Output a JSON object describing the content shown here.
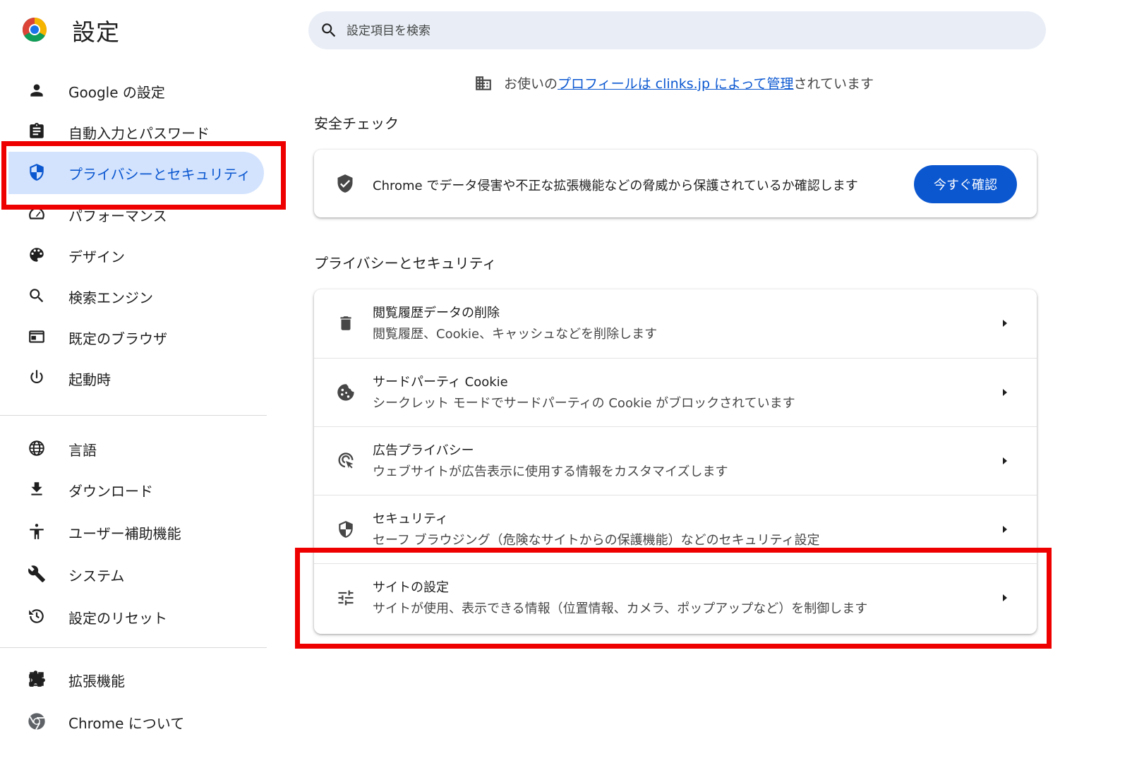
{
  "header": {
    "app_title": "設定",
    "search_placeholder": "設定項目を検索"
  },
  "sidebar": {
    "items": [
      {
        "label": "Google の設定",
        "icon": "person-icon"
      },
      {
        "label": "自動入力とパスワード",
        "icon": "clipboard-icon"
      },
      {
        "label": "プライバシーとセキュリティ",
        "icon": "shield-icon",
        "active": true
      },
      {
        "label": "パフォーマンス",
        "icon": "speedometer-icon"
      },
      {
        "label": "デザイン",
        "icon": "palette-icon"
      },
      {
        "label": "検索エンジン",
        "icon": "search-icon"
      },
      {
        "label": "既定のブラウザ",
        "icon": "browser-window-icon"
      },
      {
        "label": "起動時",
        "icon": "power-icon"
      },
      {
        "label": "言語",
        "icon": "globe-icon"
      },
      {
        "label": "ダウンロード",
        "icon": "download-icon"
      },
      {
        "label": "ユーザー補助機能",
        "icon": "accessibility-icon"
      },
      {
        "label": "システム",
        "icon": "wrench-icon"
      },
      {
        "label": "設定のリセット",
        "icon": "history-icon"
      },
      {
        "label": "拡張機能",
        "icon": "puzzle-icon"
      },
      {
        "label": "Chrome について",
        "icon": "chrome-icon"
      }
    ]
  },
  "managed_notice": {
    "prefix": "お使いの",
    "link": "プロフィールは clinks.jp によって管理",
    "suffix": "されています"
  },
  "safety_check": {
    "title": "安全チェック",
    "text": "Chrome でデータ侵害や不正な拡張機能などの脅威から保護されているか確認します",
    "button": "今すぐ確認"
  },
  "privacy": {
    "title": "プライバシーとセキュリティ",
    "rows": [
      {
        "title": "閲覧履歴データの削除",
        "desc": "閲覧履歴、Cookie、キャッシュなどを削除します",
        "icon": "trash-icon"
      },
      {
        "title": "サードパーティ Cookie",
        "desc": "シークレット モードでサードパーティの Cookie がブロックされています",
        "icon": "cookie-icon"
      },
      {
        "title": "広告プライバシー",
        "desc": "ウェブサイトが広告表示に使用する情報をカスタマイズします",
        "icon": "ad-privacy-icon"
      },
      {
        "title": "セキュリティ",
        "desc": "セーフ ブラウジング（危険なサイトからの保護機能）などのセキュリティ設定",
        "icon": "shield-icon"
      },
      {
        "title": "サイトの設定",
        "desc": "サイトが使用、表示できる情報（位置情報、カメラ、ポップアップなど）を制御します",
        "icon": "sliders-icon"
      }
    ]
  },
  "colors": {
    "accent": "#0b57d0",
    "active_nav_bg": "#d3e3fd",
    "search_bg": "#e9eef6",
    "highlight": "#ee0000"
  }
}
